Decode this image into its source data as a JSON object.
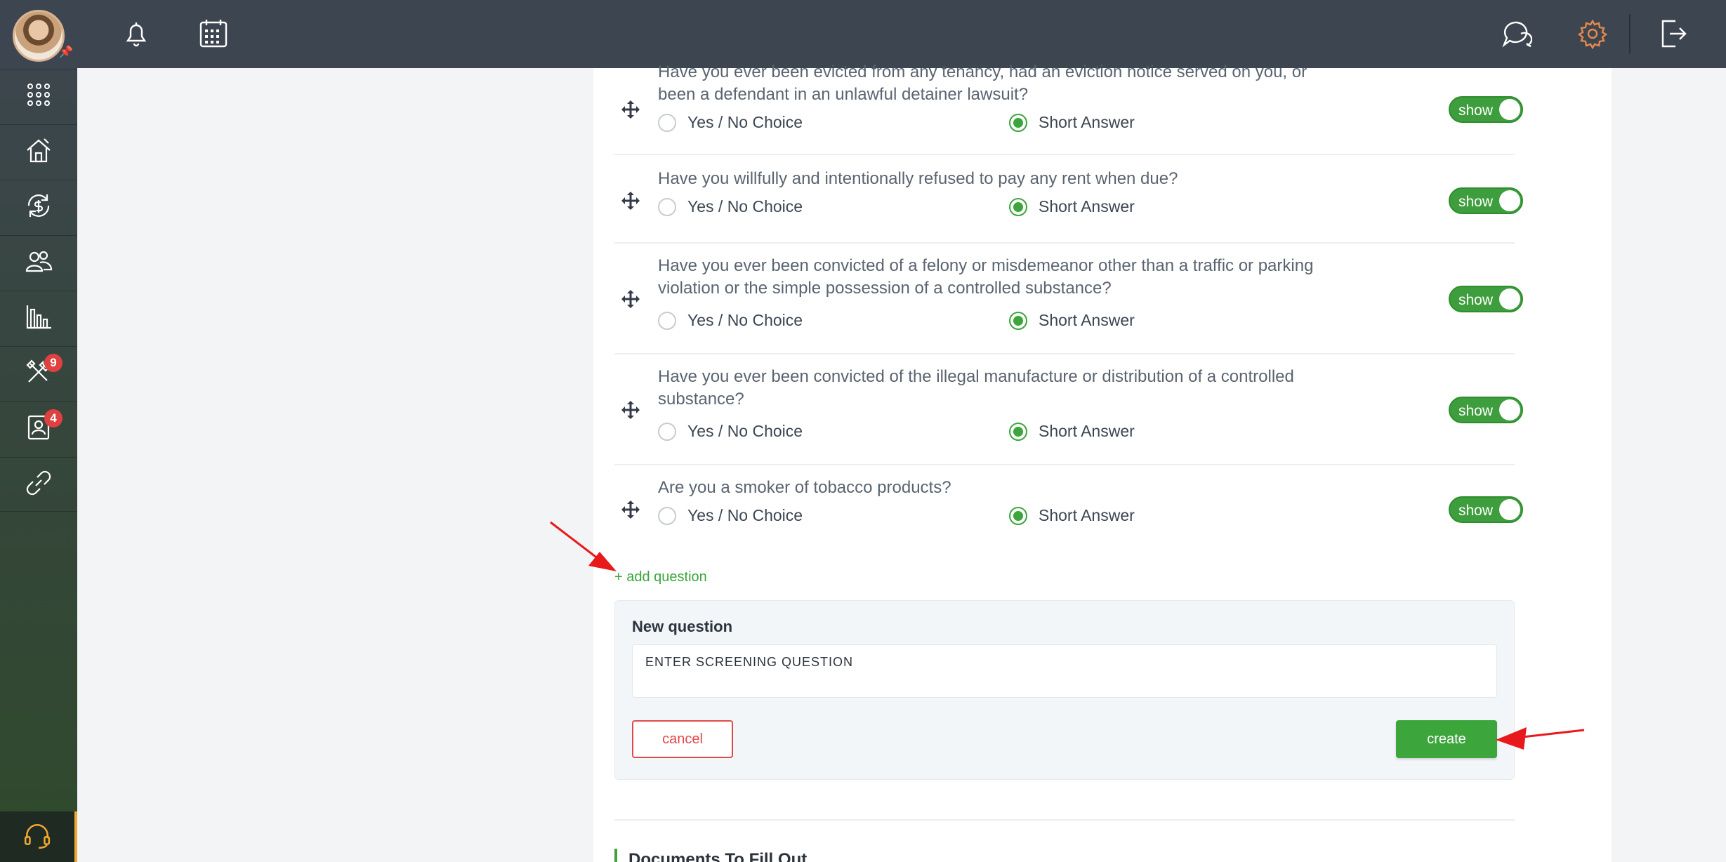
{
  "sidebar": {
    "items": [
      {
        "icon": "apps-grid-icon"
      },
      {
        "icon": "property-house-icon"
      },
      {
        "icon": "payments-cycle-icon"
      },
      {
        "icon": "tenants-people-icon"
      },
      {
        "icon": "reports-chart-icon"
      },
      {
        "icon": "maintenance-tools-icon",
        "badge": "9"
      },
      {
        "icon": "applications-contact-icon",
        "badge": "4"
      },
      {
        "icon": "link-icon"
      }
    ],
    "support_icon": "headset-icon"
  },
  "topbar": {
    "icons": [
      "bell-icon",
      "calendar-icon",
      "chat-icon",
      "gear-icon",
      "logout-icon"
    ],
    "active_color": "#e8894a"
  },
  "questions": [
    {
      "text": "Have you ever been evicted from any tenancy, had an eviction notice served on you, or been a defendant in an unlawful detainer lawsuit?",
      "option_a": "Yes / No Choice",
      "option_b": "Short Answer",
      "selected": "b",
      "toggle": "show"
    },
    {
      "text": "Have you willfully and intentionally refused to pay any rent when due?",
      "option_a": "Yes / No Choice",
      "option_b": "Short Answer",
      "selected": "b",
      "toggle": "show"
    },
    {
      "text": "Have you ever been convicted of a felony or misdemeanor other than a traffic or parking violation or the simple possession of a controlled substance?",
      "option_a": "Yes / No Choice",
      "option_b": "Short Answer",
      "selected": "b",
      "toggle": "show"
    },
    {
      "text": "Have you ever been convicted of the illegal manufacture or distribution of a controlled substance?",
      "option_a": "Yes / No Choice",
      "option_b": "Short Answer",
      "selected": "b",
      "toggle": "show"
    },
    {
      "text": "Are you a smoker of tobacco products?",
      "option_a": "Yes / No Choice",
      "option_b": "Short Answer",
      "selected": "b",
      "toggle": "show"
    }
  ],
  "add_question_label": "+ add question",
  "new_question": {
    "title": "New question",
    "input_value": "ENTER SCREENING QUESTION",
    "cancel_label": "cancel",
    "create_label": "create"
  },
  "documents_title": "Documents To Fill Out",
  "colors": {
    "accent_green": "#3ca53c",
    "danger_red": "#e0494a",
    "topbar": "#3d4650"
  }
}
